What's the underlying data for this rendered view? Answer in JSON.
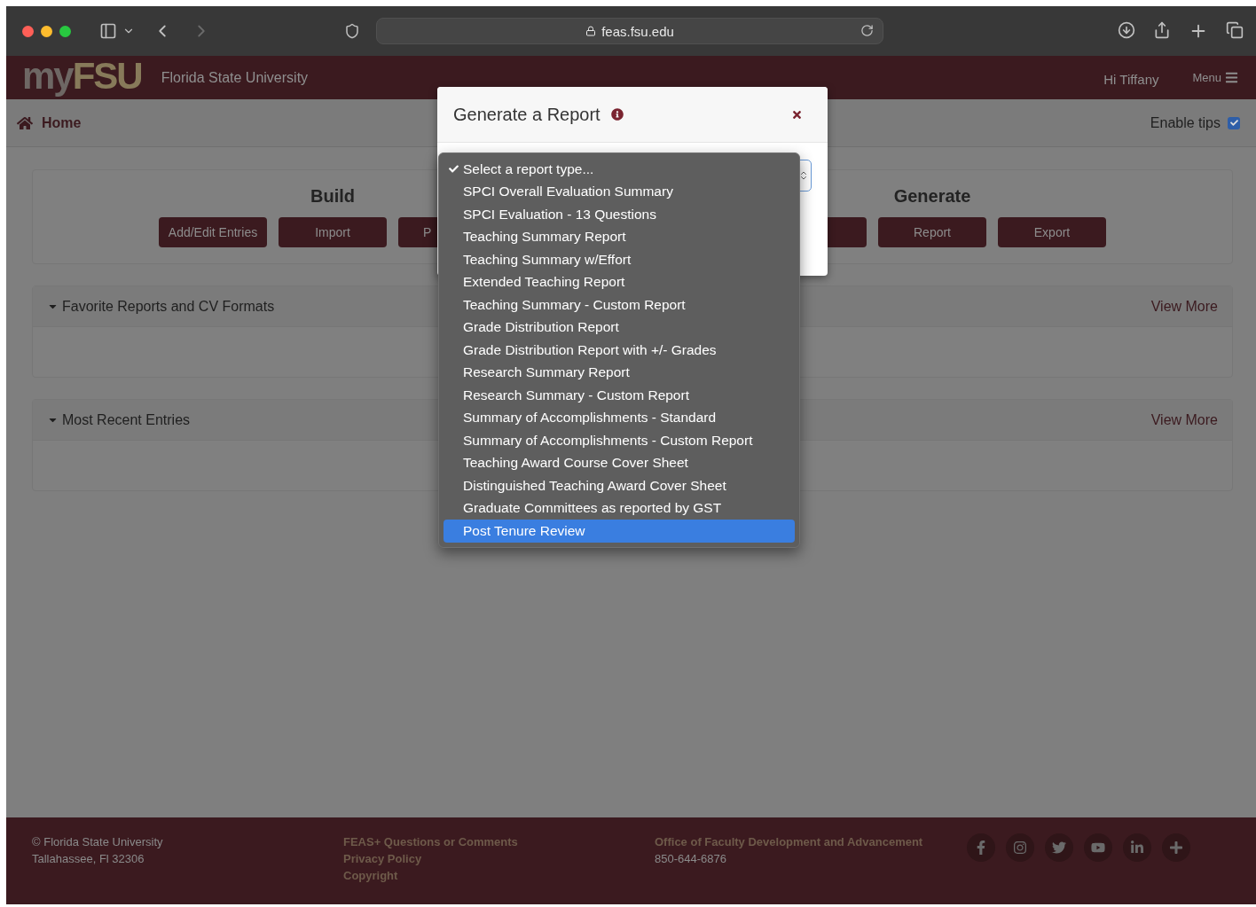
{
  "browser": {
    "url": "feas.fsu.edu"
  },
  "header": {
    "logo": {
      "prefix": "my",
      "suffix": "FSU"
    },
    "site_name": "Florida State University",
    "greeting": "Hi Tiffany",
    "menu": "Menu"
  },
  "breadcrumb": {
    "home": "Home",
    "enable_tips": {
      "label": "Enable tips",
      "checked": true
    }
  },
  "actions": [
    {
      "title": "Build",
      "buttons": [
        "Add/Edit Entries",
        "Import",
        "P"
      ]
    },
    {
      "title": "Generate",
      "buttons": [
        "Report",
        "Export"
      ]
    }
  ],
  "panels": [
    {
      "title": "Favorite Reports and CV Formats",
      "link": "View More",
      "expanded": true
    },
    {
      "title": "Most Recent Entries",
      "link": "View More",
      "expanded": true
    }
  ],
  "modal": {
    "title": "Generate a Report"
  },
  "report_menu": {
    "options": [
      {
        "label": "Select a report type...",
        "checked": true,
        "selected": false
      },
      {
        "label": "SPCI Overall Evaluation Summary",
        "checked": false,
        "selected": false
      },
      {
        "label": "SPCI Evaluation - 13 Questions",
        "checked": false,
        "selected": false
      },
      {
        "label": "Teaching Summary Report",
        "checked": false,
        "selected": false
      },
      {
        "label": "Teaching Summary w/Effort",
        "checked": false,
        "selected": false
      },
      {
        "label": "Extended Teaching Report",
        "checked": false,
        "selected": false
      },
      {
        "label": "Teaching Summary - Custom Report",
        "checked": false,
        "selected": false
      },
      {
        "label": "Grade Distribution Report",
        "checked": false,
        "selected": false
      },
      {
        "label": "Grade Distribution Report with +/- Grades",
        "checked": false,
        "selected": false
      },
      {
        "label": "Research Summary Report",
        "checked": false,
        "selected": false
      },
      {
        "label": "Research Summary - Custom Report",
        "checked": false,
        "selected": false
      },
      {
        "label": "Summary of Accomplishments - Standard",
        "checked": false,
        "selected": false
      },
      {
        "label": "Summary of Accomplishments - Custom Report",
        "checked": false,
        "selected": false
      },
      {
        "label": "Teaching Award Course Cover Sheet",
        "checked": false,
        "selected": false
      },
      {
        "label": "Distinguished Teaching Award Cover Sheet",
        "checked": false,
        "selected": false
      },
      {
        "label": "Graduate Committees as reported by GST",
        "checked": false,
        "selected": false
      },
      {
        "label": "Post Tenure Review",
        "checked": false,
        "selected": true
      }
    ]
  },
  "footer": {
    "address": [
      "© Florida State University",
      "Tallahassee, Fl 32306"
    ],
    "links": [
      "FEAS+ Questions or Comments",
      "Privacy Policy",
      "Copyright"
    ],
    "office": {
      "name": "Office of Faculty Development and Advancement",
      "phone": "850-644-6876"
    },
    "social": [
      {
        "kind": "facebook"
      },
      {
        "kind": "instagram"
      },
      {
        "kind": "twitter"
      },
      {
        "kind": "youtube"
      },
      {
        "kind": "linkedin"
      },
      {
        "kind": "plus"
      }
    ]
  }
}
